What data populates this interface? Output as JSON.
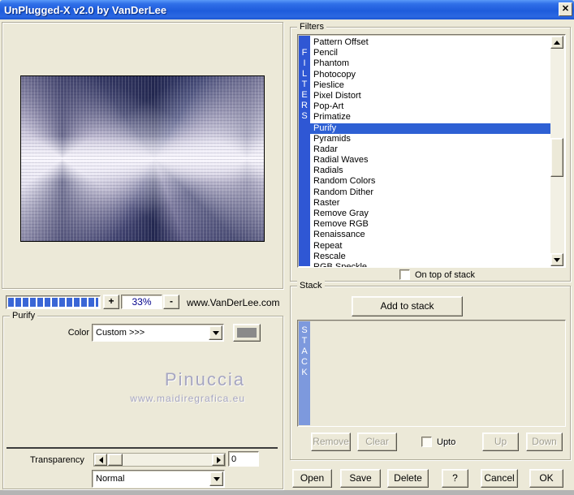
{
  "window": {
    "title": "UnPlugged-X v2.0 by VanDerLee",
    "close_label": "✕"
  },
  "preview": {
    "zoom_in_label": "+",
    "zoom_level": "33%",
    "zoom_out_label": "-",
    "site_link": "www.VanDerLee.com",
    "progress_segments": 13
  },
  "purify": {
    "group_label": "Purify",
    "color_label": "Color",
    "color_value": "Custom >>>",
    "watermark_name": "Pinuccia",
    "watermark_url": "www.maidiregrafica.eu",
    "transparency_label": "Transparency",
    "transparency_value": "0",
    "blend_mode_value": "Normal"
  },
  "filters": {
    "group_label": "Filters",
    "side_label": "FILTERS",
    "selected_index": 8,
    "items": [
      "Pattern Offset",
      "Pencil",
      "Phantom",
      "Photocopy",
      "Pieslice",
      "Pixel Distort",
      "Pop-Art",
      "Primatize",
      "Purify",
      "Pyramids",
      "Radar",
      "Radial Waves",
      "Radials",
      "Random Colors",
      "Random Dither",
      "Raster",
      "Remove Gray",
      "Remove RGB",
      "Renaissance",
      "Repeat",
      "Rescale",
      "RGB Speckle"
    ],
    "on_top_label": "On top of stack"
  },
  "stack": {
    "group_label": "Stack",
    "add_button_label": "Add to stack",
    "side_label": "STACK",
    "remove_label": "Remove",
    "clear_label": "Clear",
    "upto_label": "Upto",
    "up_label": "Up",
    "down_label": "Down"
  },
  "footer": {
    "open_label": "Open",
    "save_label": "Save",
    "delete_label": "Delete",
    "help_label": "?",
    "cancel_label": "Cancel",
    "ok_label": "OK"
  },
  "colors": {
    "dialog_bg": "#ece9d8",
    "titlebar_blue": "#1e5cdc",
    "filters_bar_blue": "#2f57d4",
    "selection_blue": "#2e60d4",
    "stack_bar_blue": "#7d99dd",
    "progress_blue": "#3a66d6",
    "zoom_text_navy": "#00008b",
    "watermark_purple": "#a6a6c2"
  }
}
